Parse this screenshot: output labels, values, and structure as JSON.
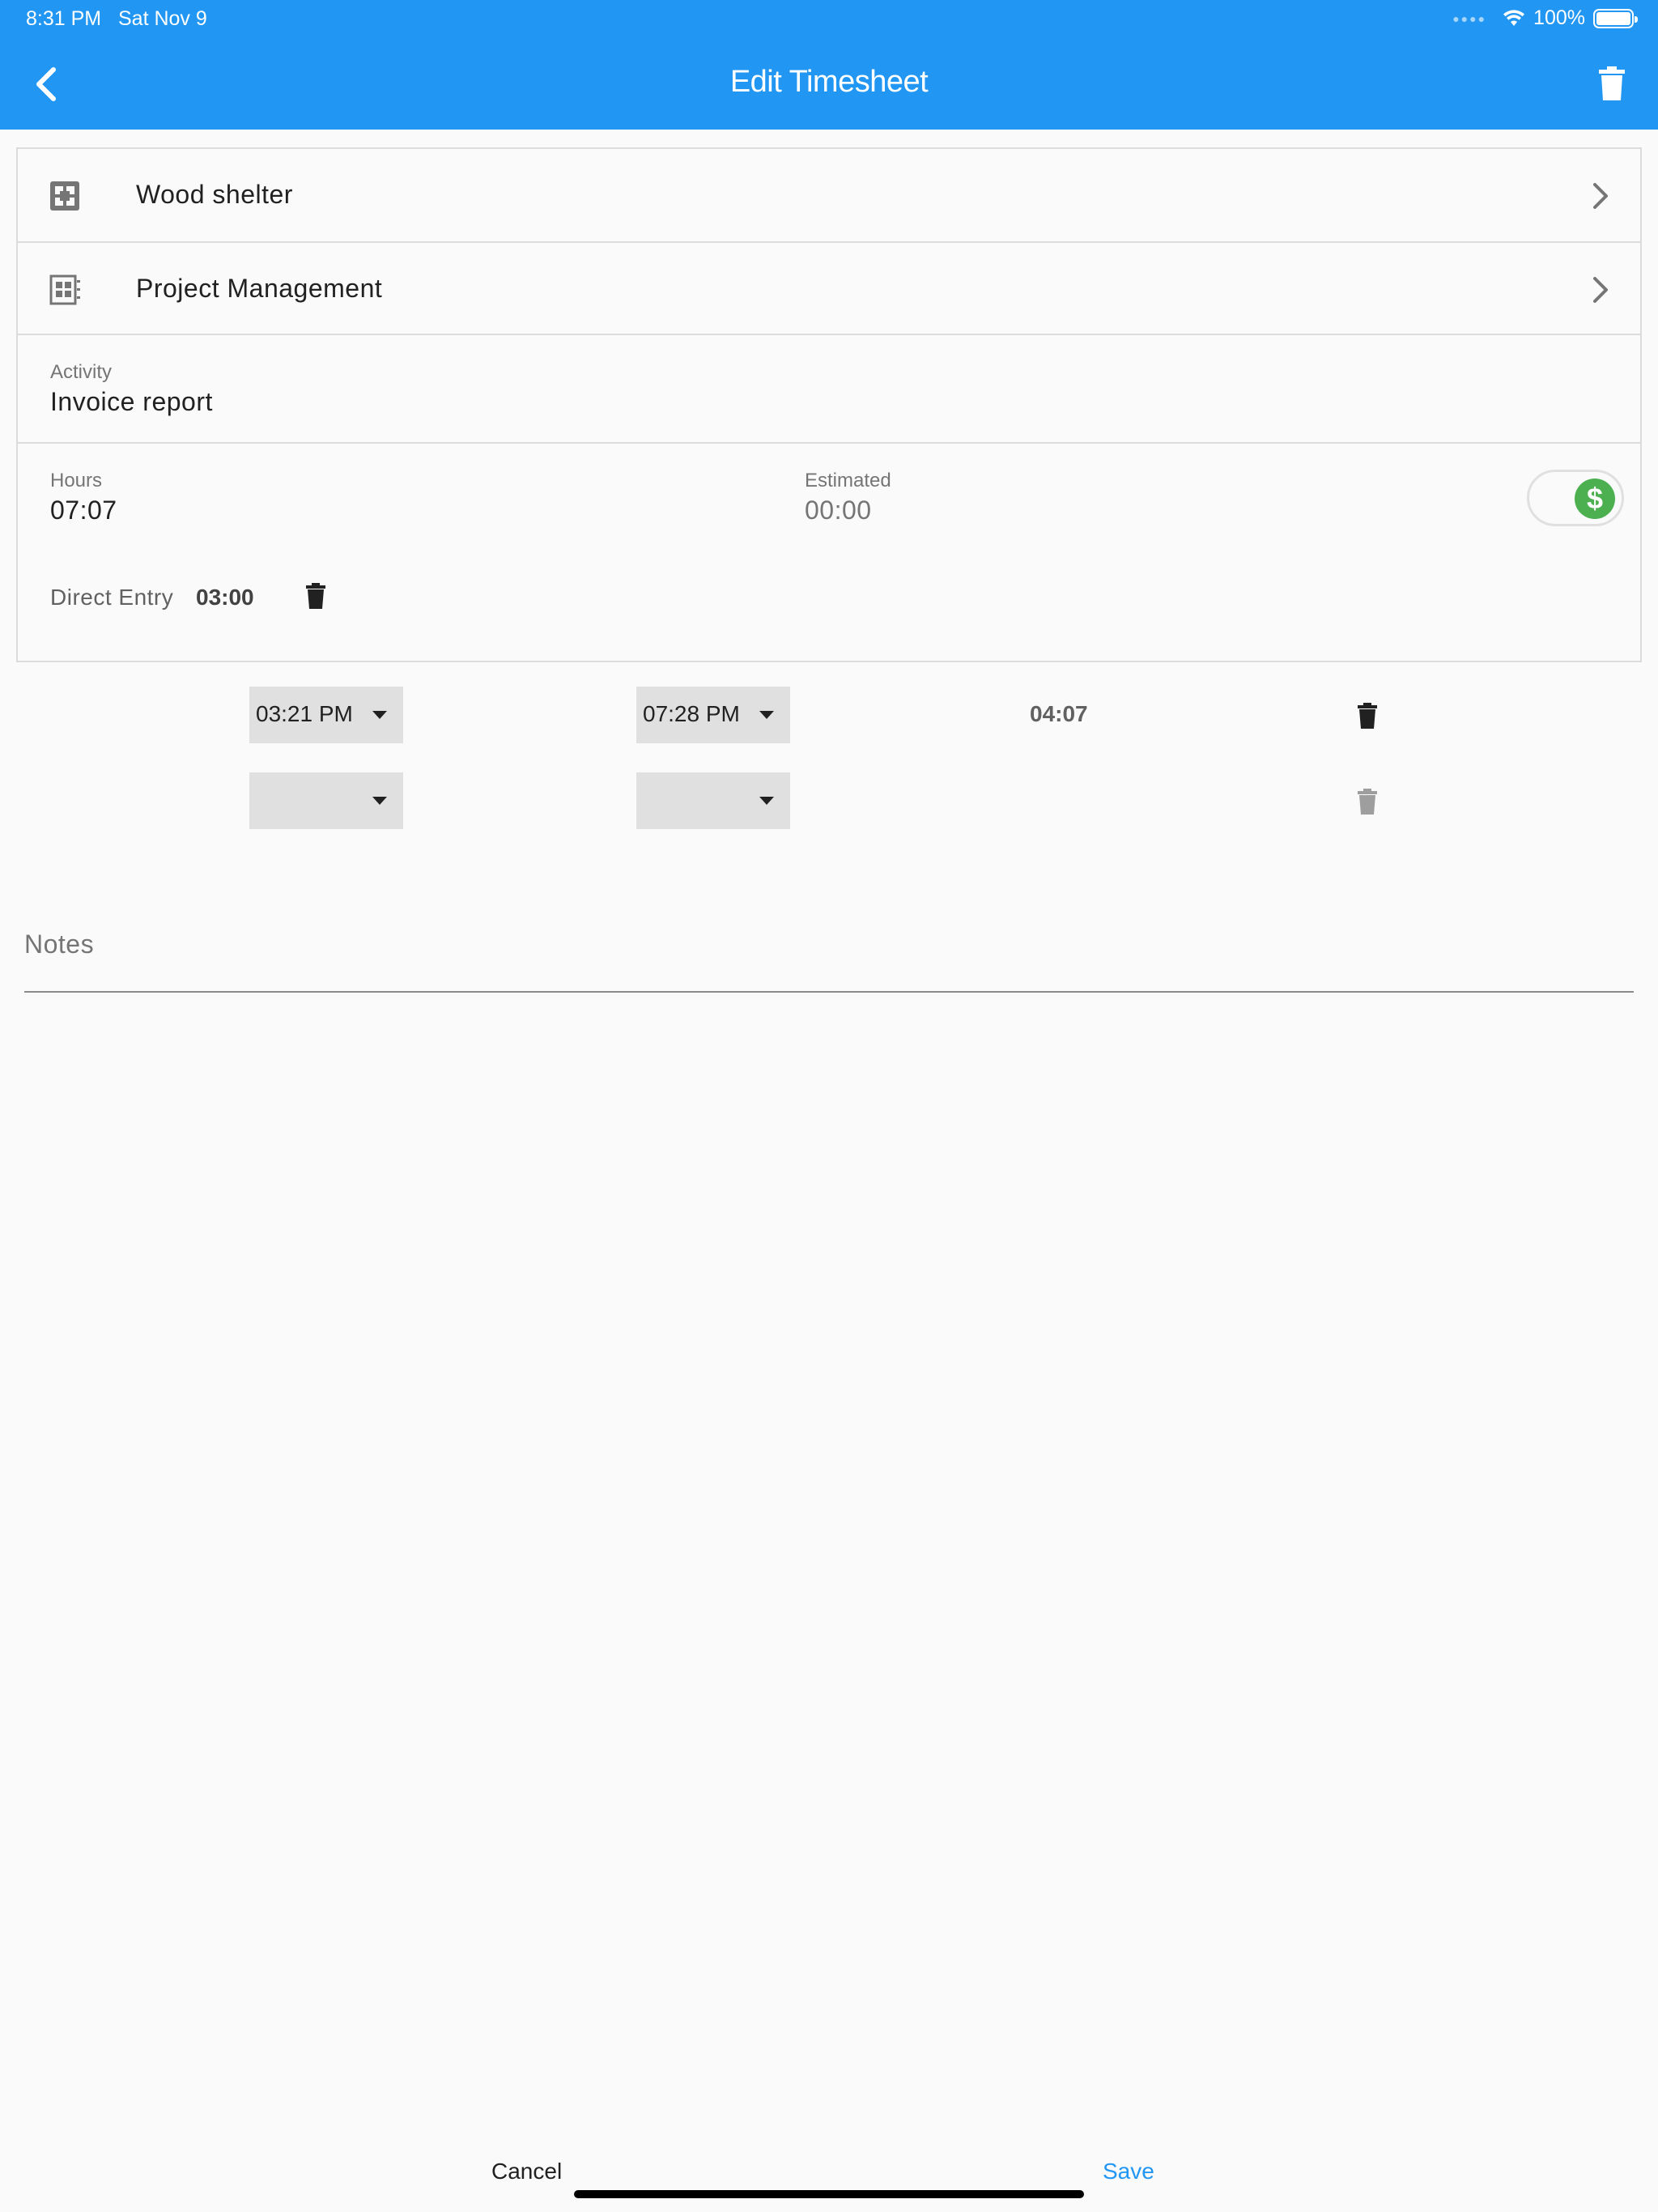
{
  "status_bar": {
    "time": "8:31 PM",
    "date": "Sat Nov 9",
    "battery": "100%"
  },
  "header": {
    "title": "Edit Timesheet",
    "color": "#2196f3"
  },
  "nav_rows": [
    {
      "label": "Wood shelter",
      "icon": "project-icon"
    },
    {
      "label": "Project Management",
      "icon": "task-icon"
    }
  ],
  "activity": {
    "label": "Activity",
    "value": "Invoice report"
  },
  "hours": {
    "label": "Hours",
    "value": "07:07",
    "estimated_label": "Estimated",
    "estimated_value": "00:00",
    "billable": true,
    "billable_icon": "dollar-icon"
  },
  "direct_entry": {
    "label": "Direct Entry",
    "value": "03:00"
  },
  "time_entries": [
    {
      "start": "03:21 PM",
      "end": "07:28 PM",
      "duration": "04:07"
    },
    {
      "start": "",
      "end": "",
      "duration": ""
    }
  ],
  "notes": {
    "label": "Notes",
    "value": ""
  },
  "footer": {
    "cancel_label": "Cancel",
    "save_label": "Save"
  }
}
